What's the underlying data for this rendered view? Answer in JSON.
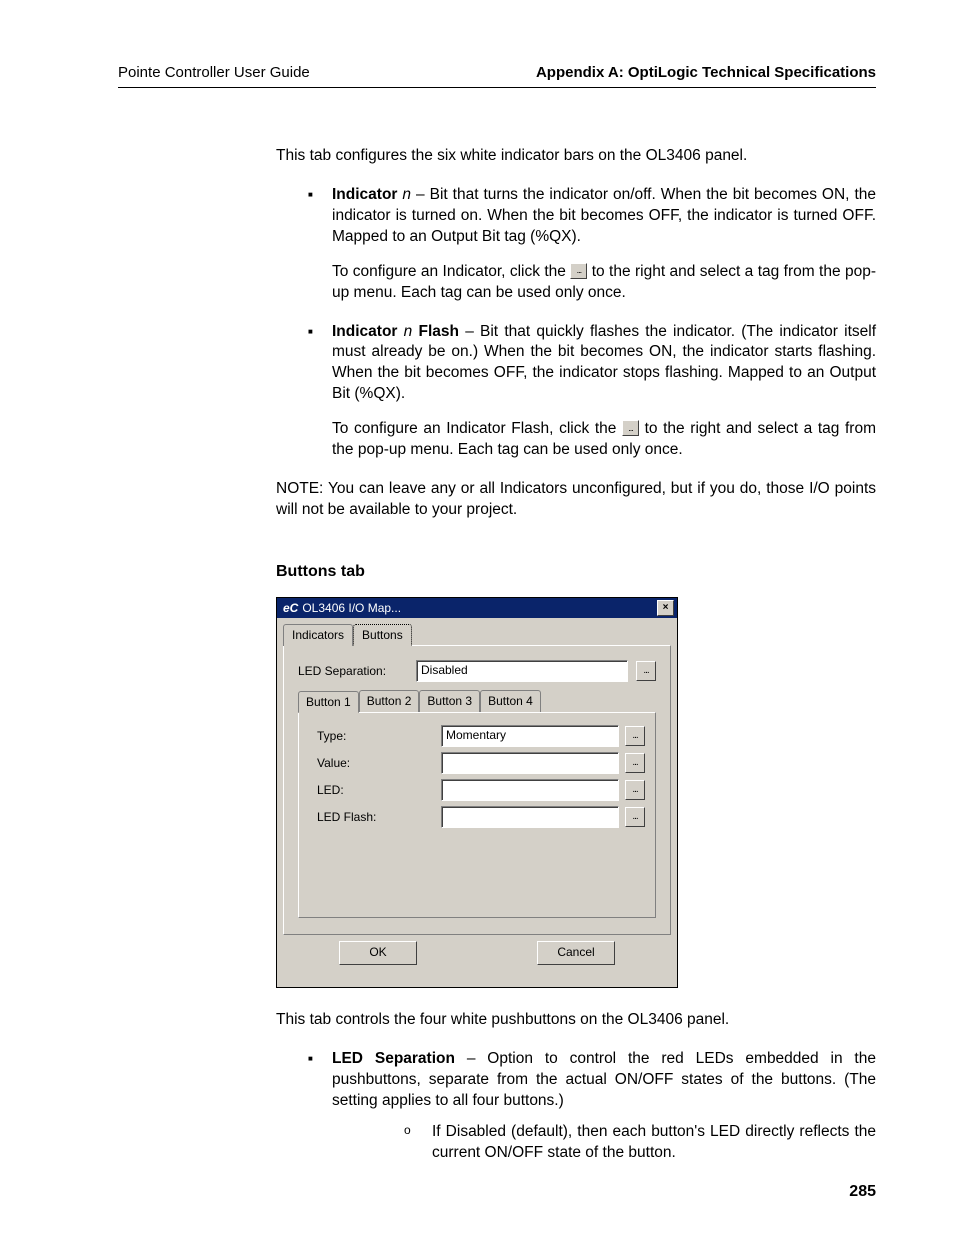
{
  "header": {
    "left": "Pointe Controller User Guide",
    "right": "Appendix A: OptiLogic Technical Specifications"
  },
  "intro": "This tab configures the six white indicator bars on the OL3406 panel.",
  "bullets": {
    "b1": {
      "label": "Indicator",
      "var": "n",
      "body": " – Bit that turns the indicator on/off. When the bit becomes ON, the indicator is turned on. When the bit becomes OFF, the indicator is turned OFF. Mapped to an Output Bit tag (%QX).",
      "sub_pre": "To configure an Indicator, click the ",
      "sub_post": " to the right and select a tag from the pop-up menu. Each tag can be used only once."
    },
    "b2": {
      "label_a": "Indicator",
      "var": "n",
      "label_b": "Flash",
      "body": " – Bit that quickly flashes the indicator. (The indicator itself must already be on.) When the bit becomes ON, the indicator starts flashing. When the bit becomes OFF, the indicator stops flashing. Mapped to an Output Bit (%QX).",
      "sub_pre": "To configure an Indicator Flash, click the ",
      "sub_post": " to the right and select a tag from the pop-up menu. Each tag can be used only once."
    }
  },
  "note": "NOTE: You can leave any or all Indicators unconfigured, but if you do, those I/O points will not be available to your project.",
  "section": "Buttons tab",
  "dialog": {
    "title_logo": "eC",
    "title": "OL3406 I/O Map...",
    "close": "×",
    "tabs": {
      "t1": "Indicators",
      "t2": "Buttons"
    },
    "led_sep_label": "LED Separation:",
    "led_sep_value": "Disabled",
    "btntabs": {
      "b1": "Button 1",
      "b2": "Button 2",
      "b3": "Button 3",
      "b4": "Button 4"
    },
    "fields": {
      "type_label": "Type:",
      "type_value": "Momentary",
      "value_label": "Value:",
      "value_value": "",
      "led_label": "LED:",
      "led_value": "",
      "flash_label": "LED Flash:",
      "flash_value": ""
    },
    "ellipsis": "...",
    "ok": "OK",
    "cancel": "Cancel"
  },
  "after": "This tab controls the four white pushbuttons on the OL3406 panel.",
  "bullet3": {
    "label": "LED Separation",
    "body": " – Option to control the red LEDs embedded in the pushbuttons, separate from the actual ON/OFF states of the buttons. (The setting applies to all four buttons.)",
    "sub": "If Disabled (default), then each button's LED directly reflects the current ON/OFF state of the button."
  },
  "pageno": "285"
}
